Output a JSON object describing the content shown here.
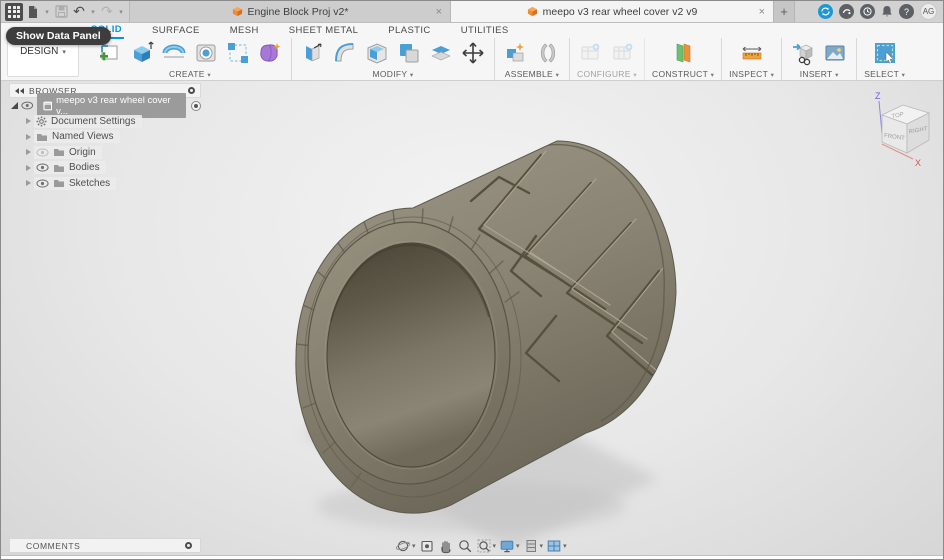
{
  "glyphs": {
    "caret": "▾",
    "close": "×",
    "plus": "+",
    "undo": "↶",
    "redo": "↷",
    "question": "?"
  },
  "tabbar": {
    "tabs": [
      {
        "title": "Engine Block Proj v2*"
      },
      {
        "title": "meepo v3 rear wheel cover v2 v9"
      }
    ],
    "account_initials": "AG"
  },
  "tooltip": {
    "text": "Show Data Panel"
  },
  "ribbon": {
    "design_label": "DESIGN",
    "tabs": [
      {
        "label": "SOLID"
      },
      {
        "label": "SURFACE"
      },
      {
        "label": "MESH"
      },
      {
        "label": "SHEET METAL"
      },
      {
        "label": "PLASTIC"
      },
      {
        "label": "UTILITIES"
      }
    ],
    "groups": [
      {
        "label": "CREATE"
      },
      {
        "label": "MODIFY"
      },
      {
        "label": "ASSEMBLE"
      },
      {
        "label": "CONFIGURE"
      },
      {
        "label": "CONSTRUCT"
      },
      {
        "label": "INSPECT"
      },
      {
        "label": "INSERT"
      },
      {
        "label": "SELECT"
      }
    ]
  },
  "browser": {
    "title": "BROWSER",
    "root_label": "meepo v3 rear wheel cover v...",
    "items": [
      {
        "label": "Document Settings"
      },
      {
        "label": "Named Views"
      },
      {
        "label": "Origin"
      },
      {
        "label": "Bodies"
      },
      {
        "label": "Sketches"
      }
    ]
  },
  "viewcube": {
    "top": "TOP",
    "front": "FRONT",
    "right": "RIGHT",
    "axis_z": "Z",
    "axis_x": "X"
  },
  "comments": {
    "label": "COMMENTS"
  },
  "navbar": {
    "icons": [
      "orbit",
      "look-at",
      "pan",
      "zoom",
      "fit",
      "display-settings",
      "grid-snaps",
      "viewports"
    ]
  },
  "colors": {
    "accent_blue": "#0696d7",
    "model_olive": "#8b8575",
    "axis_x_red": "#d8504a",
    "axis_z_blue": "#6b5fd6",
    "fusion_doc_orange": "#ef8b33"
  }
}
